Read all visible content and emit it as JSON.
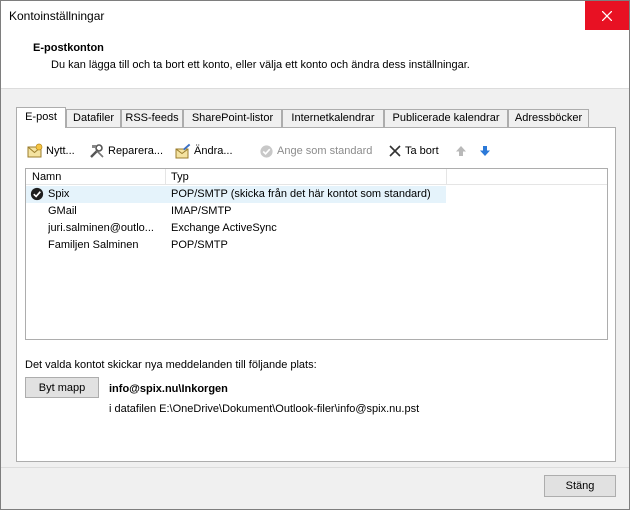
{
  "window": {
    "title": "Kontoinställningar"
  },
  "header": {
    "title": "E-postkonton",
    "subtitle": "Du kan lägga till och ta bort ett konto, eller välja ett konto och ändra dess inställningar."
  },
  "tabs": [
    {
      "label": "E-post",
      "active": true
    },
    {
      "label": "Datafiler"
    },
    {
      "label": "RSS-feeds"
    },
    {
      "label": "SharePoint-listor"
    },
    {
      "label": "Internetkalendrar"
    },
    {
      "label": "Publicerade kalendrar"
    },
    {
      "label": "Adressböcker"
    }
  ],
  "toolbar": {
    "new": "Nytt...",
    "repair": "Reparera...",
    "change": "Ändra...",
    "set_default": "Ange som standard",
    "remove": "Ta bort"
  },
  "list": {
    "columns": [
      "Namn",
      "Typ"
    ],
    "rows": [
      {
        "name": "Spix",
        "type": "POP/SMTP (skicka från det här kontot som standard)",
        "default": true
      },
      {
        "name": "GMail",
        "type": "IMAP/SMTP"
      },
      {
        "name": "juri.salminen@outlo...",
        "type": "Exchange ActiveSync"
      },
      {
        "name": "Familjen Salminen",
        "type": "POP/SMTP"
      }
    ]
  },
  "delivery": {
    "description": "Det valda kontot skickar nya meddelanden till följande plats:",
    "change_folder": "Byt mapp",
    "location": "info@spix.nu\\Inkorgen",
    "datafile": "i datafilen E:\\OneDrive\\Dokument\\Outlook-filer\\info@spix.nu.pst"
  },
  "footer": {
    "close": "Stäng"
  },
  "colors": {
    "close_hover": "#e81123",
    "selection": "#e5f3fb",
    "accent_blue": "#2b79d8"
  }
}
